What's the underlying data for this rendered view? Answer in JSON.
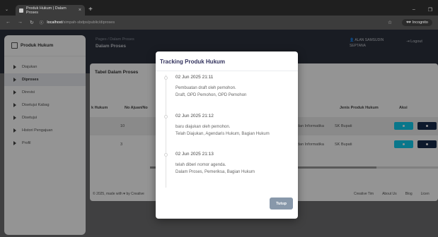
{
  "browser": {
    "tab_title": "Produk Hukum | Dalam Proses",
    "tab_close": "×",
    "new_tab": "+",
    "url_host": "localhost",
    "url_path": "/simpah-sbdps/public/diproses",
    "incognito_label": "Incognito"
  },
  "header": {
    "breadcrumb": "Pages  /  Dalam Proses",
    "page_title": "Dalam Proses",
    "user_name": "ALAN SAMSUDIN",
    "user_name2": "SEPTANA",
    "logout": "Logout"
  },
  "sidebar": {
    "brand": "Produk Hukum",
    "items": [
      {
        "label": "Diajukan"
      },
      {
        "label": "Diproses"
      },
      {
        "label": "Direvisi"
      },
      {
        "label": "Disetujui Kabag"
      },
      {
        "label": "Disetujui"
      },
      {
        "label": "Histori Pengajuan"
      },
      {
        "label": "Profil"
      }
    ]
  },
  "card": {
    "title": "Tabel Dalam Proses",
    "columns": {
      "no_hukum": "k Hukum",
      "no_ajuan": "No Ajuan/No",
      "jenis": "Jenis Produk Hukum",
      "aksi": "Aksi"
    },
    "rows": [
      {
        "no": "10",
        "dinas": "dan Informatika",
        "jenis": "SK Bupati"
      },
      {
        "no": "3",
        "dinas": "dan Informatika",
        "jenis": "SK Bupati"
      }
    ]
  },
  "footer": {
    "copy": "© 2025, made with ♥ by Creative",
    "links": [
      "Creative Tim",
      "About Us",
      "Blog",
      "Licen"
    ]
  },
  "modal": {
    "title": "Tracking Produk Hukum",
    "entries": [
      {
        "date": "02 Jun 2025 21:11",
        "line1": "Pembuatan draft oleh pemohon.",
        "line2": "Draft, OPD Pemohon, OPD Pemohon"
      },
      {
        "date": "02 Jun 2025 21:12",
        "line1": "baru diajukan oleh pemohon.",
        "line2": "Telah Diajukan, Agendaris Hukum, Bagian Hukum"
      },
      {
        "date": "02 Jun 2025 21:13",
        "line1": "telah diberi nomor agenda.",
        "line2": "Dalam Proses, Pemeriksa, Bagian Hukum"
      }
    ],
    "close_label": "Tutup"
  },
  "colors": {
    "header_band": "#2c313d",
    "btn_info": "#11cdef",
    "btn_dark": "#172b4d",
    "btn_close": "#8898aa",
    "modal_title": "#32325d"
  }
}
